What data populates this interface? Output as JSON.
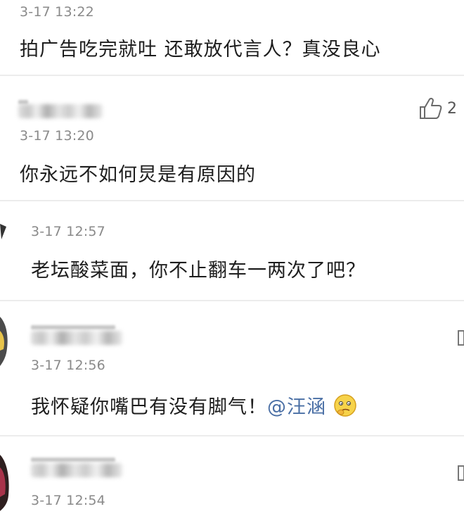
{
  "comments": [
    {
      "time": "3-17 13:22",
      "text": "拍广告吃完就吐 还敢放代言人？真没良心"
    },
    {
      "time": "3-17 13:20",
      "text": "你永远不如何炅是有原因的",
      "likes": "2"
    },
    {
      "time": "3-17 12:57",
      "text": "老坛酸菜面，你不止翻车一两次了吧？"
    },
    {
      "time": "3-17 12:56",
      "text": "我怀疑你嘴巴有没有脚气！",
      "mention": "@汪涵",
      "emoji": "thinking-face-emoji"
    },
    {
      "time": "3-17 12:54"
    }
  ],
  "icons": {
    "like": "thumbs-up-icon",
    "more": "more-icon",
    "accent": "#4a6fa5"
  }
}
